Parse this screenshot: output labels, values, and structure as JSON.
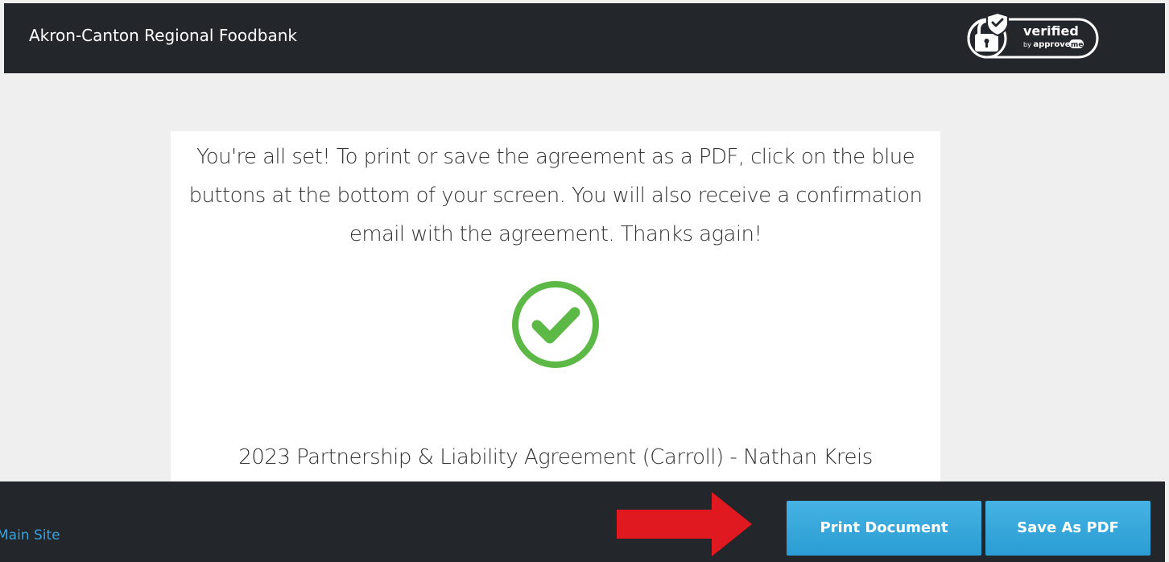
{
  "header": {
    "org_name": "Akron-Canton Regional Foodbank",
    "badge": {
      "text": "verified",
      "by_text": "by approve",
      "brand_suffix": "me",
      "icon": "shield-lock-icon"
    }
  },
  "card": {
    "message": "You're all set! To print or save the agreement as a PDF, click on the blue buttons at the bottom of your screen. You will also receive a confirmation email with the agreement. Thanks again!",
    "status_icon": "check-circle-icon",
    "document_title": "2023 Partnership & Liability Agreement (Carroll) - Nathan Kreis"
  },
  "footer": {
    "main_site_link": "Main Site",
    "print_button": "Print Document",
    "save_button": "Save As PDF",
    "annotation": "red-arrow-icon"
  },
  "colors": {
    "bar_background": "#23262b",
    "page_background": "#efefef",
    "card_background": "#ffffff",
    "accent_green": "#5cb946",
    "button_blue": "#2fa3d9",
    "link_blue": "#3aa0d8",
    "arrow_red": "#e0181f"
  }
}
